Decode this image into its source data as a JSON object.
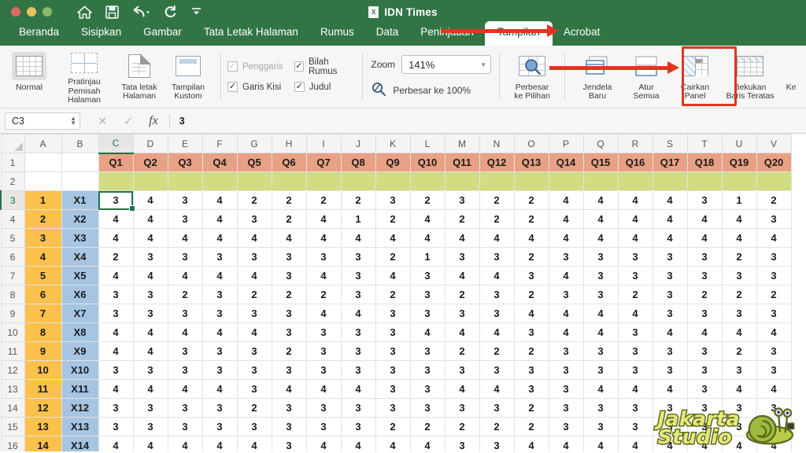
{
  "window": {
    "document_title": "IDN Times",
    "traffic_lights": [
      "close-red",
      "minimize-yellow",
      "maximize-green"
    ],
    "quick_access": [
      "home-icon",
      "save-icon",
      "undo-icon",
      "redo-icon",
      "customize-toolbar-icon"
    ]
  },
  "tabs": [
    {
      "label": "Beranda",
      "active": false
    },
    {
      "label": "Sisipkan",
      "active": false
    },
    {
      "label": "Gambar",
      "active": false
    },
    {
      "label": "Tata Letak Halaman",
      "active": false
    },
    {
      "label": "Rumus",
      "active": false
    },
    {
      "label": "Data",
      "active": false
    },
    {
      "label": "Peninjauan",
      "active": false
    },
    {
      "label": "Tampilan",
      "active": true
    },
    {
      "label": "Acrobat",
      "active": false
    }
  ],
  "ribbon": {
    "views": [
      {
        "label_line1": "Normal",
        "label_line2": "",
        "icon": "normal-view-icon",
        "selected": true
      },
      {
        "label_line1": "Pratinjau",
        "label_line2": "Pemisah Halaman",
        "icon": "page-break-preview-icon",
        "selected": false
      },
      {
        "label_line1": "Tata letak",
        "label_line2": "Halaman",
        "icon": "page-layout-icon",
        "selected": false
      },
      {
        "label_line1": "Tampilan",
        "label_line2": "Kustom",
        "icon": "custom-view-icon",
        "selected": false
      }
    ],
    "checkboxes": [
      {
        "label": "Penggaris",
        "checked": true,
        "disabled": true
      },
      {
        "label": "Bilah Rumus",
        "checked": true,
        "disabled": false
      },
      {
        "label": "Garis Kisi",
        "checked": true,
        "disabled": false
      },
      {
        "label": "Judul",
        "checked": true,
        "disabled": false
      }
    ],
    "zoom": {
      "label": "Zoom",
      "value": "141%",
      "reset_label": "Perbesar ke 100%",
      "reset_icon": "zoom-100-icon"
    },
    "buttons": [
      {
        "label_line1": "Perbesar",
        "label_line2": "ke Pilihan",
        "icon": "zoom-to-selection-icon",
        "highlighted": false
      },
      {
        "label_line1": "Jendela",
        "label_line2": "Baru",
        "icon": "new-window-icon",
        "highlighted": false
      },
      {
        "label_line1": "Atur",
        "label_line2": "Semua",
        "icon": "arrange-all-icon",
        "highlighted": false
      },
      {
        "label_line1": "Cairkan",
        "label_line2": "Panel",
        "icon": "unfreeze-panes-icon",
        "highlighted": true
      },
      {
        "label_line1": "Bekukan",
        "label_line2": "Baris Teratas",
        "icon": "freeze-top-row-icon",
        "highlighted": false
      },
      {
        "label_line1": "Ke",
        "label_line2": "",
        "icon": "freeze-first-column-icon",
        "highlighted": false
      }
    ]
  },
  "formula_bar": {
    "name_box": "C3",
    "cancel_icon": "cancel-icon",
    "accept_icon": "accept-icon",
    "function_icon": "fx-icon",
    "content": "3"
  },
  "sheet": {
    "column_headers": [
      "A",
      "B",
      "C",
      "D",
      "E",
      "F",
      "G",
      "H",
      "I",
      "J",
      "K",
      "L",
      "M",
      "N",
      "O",
      "P",
      "Q",
      "R",
      "S",
      "T",
      "U",
      "V"
    ],
    "selected_column": "C",
    "row_headers": [
      "1",
      "2",
      "3",
      "4",
      "5",
      "6",
      "7",
      "8",
      "9",
      "10",
      "11",
      "12",
      "13",
      "14",
      "15",
      "16"
    ],
    "selected_row": "3",
    "active_cell": "C3",
    "q_headers": [
      "Q1",
      "Q2",
      "Q3",
      "Q4",
      "Q5",
      "Q6",
      "Q7",
      "Q8",
      "Q9",
      "Q10",
      "Q11",
      "Q12",
      "Q13",
      "Q14",
      "Q15",
      "Q16",
      "Q17",
      "Q18",
      "Q19",
      "Q20"
    ],
    "index_column": [
      "1",
      "2",
      "3",
      "4",
      "5",
      "6",
      "7",
      "8",
      "9",
      "10",
      "11",
      "12",
      "13",
      "14"
    ],
    "label_column": [
      "X1",
      "X2",
      "X3",
      "X4",
      "X5",
      "X6",
      "X7",
      "X8",
      "X9",
      "X10",
      "X11",
      "X12",
      "X13",
      "X14"
    ],
    "data": [
      [
        3,
        4,
        3,
        4,
        2,
        2,
        2,
        2,
        3,
        2,
        3,
        2,
        2,
        4,
        4,
        4,
        4,
        3,
        1,
        2
      ],
      [
        4,
        4,
        3,
        4,
        3,
        2,
        4,
        1,
        2,
        4,
        2,
        2,
        2,
        4,
        4,
        4,
        4,
        4,
        4,
        3
      ],
      [
        4,
        4,
        4,
        4,
        4,
        4,
        4,
        4,
        4,
        4,
        4,
        4,
        4,
        4,
        4,
        4,
        4,
        4,
        4,
        4
      ],
      [
        2,
        3,
        3,
        3,
        3,
        3,
        3,
        3,
        2,
        1,
        3,
        3,
        2,
        3,
        3,
        3,
        3,
        3,
        2,
        3
      ],
      [
        4,
        4,
        4,
        4,
        4,
        3,
        4,
        3,
        4,
        3,
        4,
        4,
        3,
        4,
        3,
        3,
        3,
        3,
        3,
        3
      ],
      [
        3,
        3,
        2,
        3,
        2,
        2,
        2,
        3,
        2,
        3,
        2,
        3,
        2,
        3,
        3,
        2,
        3,
        2,
        2,
        2
      ],
      [
        3,
        3,
        3,
        3,
        3,
        3,
        4,
        4,
        3,
        3,
        3,
        3,
        4,
        4,
        4,
        4,
        3,
        3,
        3,
        3
      ],
      [
        4,
        4,
        4,
        4,
        4,
        3,
        3,
        3,
        3,
        4,
        4,
        4,
        3,
        4,
        4,
        3,
        4,
        4,
        4,
        4
      ],
      [
        4,
        4,
        3,
        3,
        3,
        2,
        3,
        3,
        3,
        3,
        2,
        2,
        2,
        3,
        3,
        3,
        3,
        3,
        2,
        3
      ],
      [
        3,
        3,
        3,
        3,
        3,
        3,
        3,
        3,
        3,
        3,
        3,
        3,
        3,
        3,
        3,
        3,
        3,
        3,
        3,
        3
      ],
      [
        4,
        4,
        4,
        4,
        3,
        4,
        4,
        4,
        3,
        3,
        4,
        4,
        3,
        3,
        4,
        4,
        4,
        3,
        4,
        4
      ],
      [
        3,
        3,
        3,
        3,
        2,
        3,
        3,
        3,
        3,
        3,
        3,
        3,
        2,
        3,
        3,
        3,
        3,
        3,
        3,
        3
      ],
      [
        3,
        3,
        3,
        3,
        3,
        3,
        3,
        3,
        2,
        2,
        2,
        2,
        2,
        3,
        3,
        3,
        3,
        3,
        3,
        3
      ],
      [
        4,
        4,
        4,
        4,
        4,
        3,
        4,
        4,
        4,
        4,
        3,
        3,
        4,
        4,
        4,
        4,
        4,
        4,
        4,
        4
      ]
    ]
  },
  "annotations": {
    "arrow_to_tab": "red-arrow-icon",
    "arrow_to_unfreeze": "red-arrow-icon",
    "highlight_box": "red-highlight-box"
  },
  "watermark": {
    "line1": "Jakarta",
    "line2": "Studio",
    "logo": "snail-logo-icon"
  },
  "colors": {
    "ribbon_green": "#327545",
    "q_header": "#e8a184",
    "band_row2": "#d3dc81",
    "index_col": "#fbc14c",
    "label_col": "#a6c5e3",
    "annotation_red": "#e0361e",
    "selection_green": "#217346"
  }
}
